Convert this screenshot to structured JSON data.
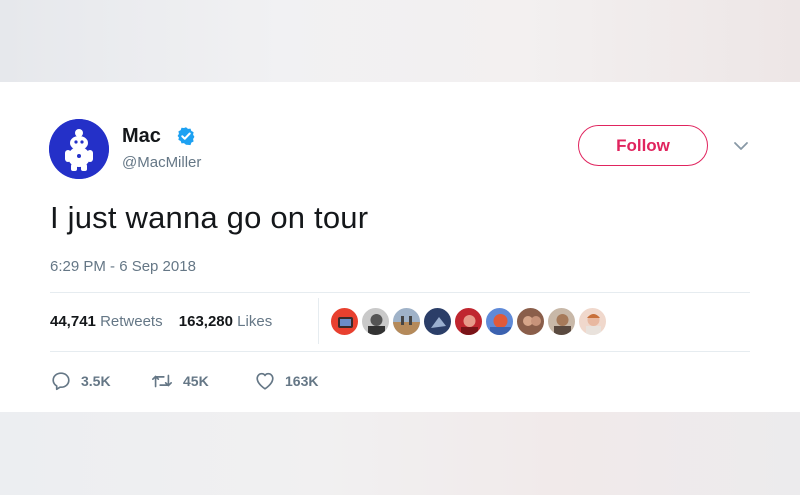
{
  "tweet": {
    "author": {
      "display_name": "Mac",
      "handle": "@MacMiller",
      "verified": true,
      "avatar_icon": "mascot-avatar"
    },
    "follow_label": "Follow",
    "text": "I just wanna go on tour",
    "timestamp": "6:29 PM - 6 Sep 2018",
    "stats": {
      "retweets_count": "44,741",
      "retweets_label": "Retweets",
      "likes_count": "163,280",
      "likes_label": "Likes"
    },
    "likers_shown": 9,
    "actions": {
      "reply_count": "3.5K",
      "retweet_count": "45K",
      "like_count": "163K"
    }
  },
  "colors": {
    "accent_red": "#e0245e",
    "verified_blue": "#1da1f2",
    "secondary_text": "#657786",
    "primary_text": "#14171a",
    "avatar_bg": "#2430c8"
  }
}
